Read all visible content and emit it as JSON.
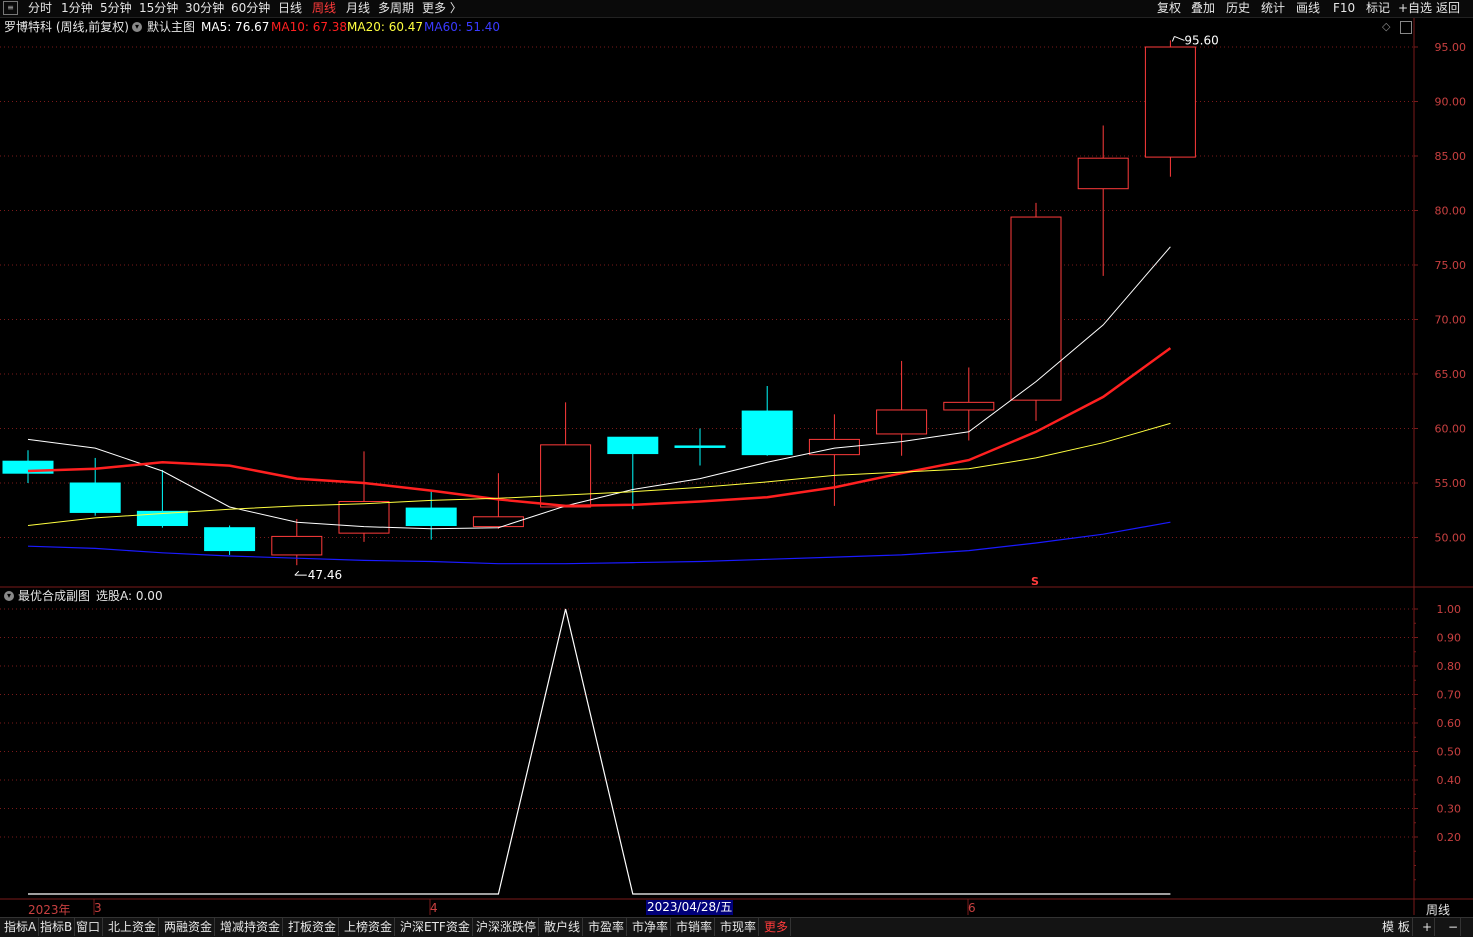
{
  "toolbar": {
    "periods": [
      "分时",
      "1分钟",
      "5分钟",
      "15分钟",
      "30分钟",
      "60分钟",
      "日线",
      "周线",
      "月线",
      "多周期",
      "更多 〉"
    ],
    "active_period": "周线",
    "right_buttons": [
      "复权",
      "叠加",
      "历史",
      "统计",
      "画线",
      "F10",
      "标记",
      "+自选",
      "返回"
    ]
  },
  "main_header": {
    "stock": "罗博特科 (周线,前复权)",
    "template": "默认主图",
    "ma5": "MA5: 76.67",
    "ma10": "MA10: 67.38",
    "ma20": "MA20: 60.47",
    "ma60": "MA60: 51.40"
  },
  "sub_header": {
    "title": "最优合成副图",
    "value": "选股A: 0.00"
  },
  "colors": {
    "up": "#ff3b3b",
    "down": "#00ffff",
    "ma5": "#ffffff",
    "ma10": "#ff2020",
    "ma20": "#ffff40",
    "ma60": "#1a1aff",
    "grid": "#7a1a1a"
  },
  "x_axis": {
    "labels": [
      "2023年",
      "3",
      "4",
      "6"
    ],
    "highlight": "2023/04/28/五",
    "period_label": "周线"
  },
  "chart_data": [
    {
      "type": "candlestick",
      "title": "",
      "ylim": [
        45.5,
        97.5
      ],
      "y_ticks": [
        "95.00",
        "90.00",
        "85.00",
        "80.00",
        "75.00",
        "70.00",
        "65.00",
        "60.00",
        "55.00",
        "50.00"
      ],
      "candles": [
        {
          "o": 57.0,
          "c": 55.9,
          "h": 58.0,
          "l": 55.0
        },
        {
          "o": 55.0,
          "c": 52.3,
          "h": 57.3,
          "l": 52.0
        },
        {
          "o": 52.4,
          "c": 51.1,
          "h": 56.2,
          "l": 50.9
        },
        {
          "o": 50.9,
          "c": 48.8,
          "h": 51.1,
          "l": 48.4
        },
        {
          "o": 48.4,
          "c": 50.1,
          "h": 51.7,
          "l": 47.46
        },
        {
          "o": 50.4,
          "c": 53.3,
          "h": 57.9,
          "l": 49.6
        },
        {
          "o": 52.7,
          "c": 51.1,
          "h": 54.4,
          "l": 49.8
        },
        {
          "o": 51.0,
          "c": 51.9,
          "h": 55.9,
          "l": 50.8
        },
        {
          "o": 52.8,
          "c": 58.5,
          "h": 62.4,
          "l": 52.8
        },
        {
          "o": 59.2,
          "c": 57.7,
          "h": 59.2,
          "l": 52.6
        },
        {
          "o": 58.4,
          "c": 58.3,
          "h": 60.0,
          "l": 56.6
        },
        {
          "o": 61.6,
          "c": 57.6,
          "h": 63.9,
          "l": 57.5
        },
        {
          "o": 57.6,
          "c": 59.0,
          "h": 61.3,
          "l": 52.9
        },
        {
          "o": 59.5,
          "c": 61.7,
          "h": 66.2,
          "l": 57.5
        },
        {
          "o": 61.7,
          "c": 62.4,
          "h": 65.6,
          "l": 58.9
        },
        {
          "o": 62.6,
          "c": 79.4,
          "h": 80.7,
          "l": 60.7
        },
        {
          "o": 82.0,
          "c": 84.8,
          "h": 87.8,
          "l": 74.0
        },
        {
          "o": 84.9,
          "c": 95.0,
          "h": 95.6,
          "l": 83.1
        }
      ],
      "series": [
        {
          "name": "MA5",
          "values": [
            59.0,
            58.2,
            56.1,
            52.8,
            51.4,
            51.0,
            50.8,
            50.9,
            52.9,
            54.4,
            55.4,
            56.9,
            58.2,
            58.8,
            59.7,
            64.3,
            69.5,
            76.67
          ]
        },
        {
          "name": "MA10",
          "values": [
            56.1,
            56.3,
            56.9,
            56.6,
            55.4,
            55.0,
            54.3,
            53.5,
            52.9,
            53.0,
            53.3,
            53.7,
            54.6,
            55.9,
            57.1,
            59.7,
            62.9,
            67.38
          ]
        },
        {
          "name": "MA20",
          "values": [
            51.1,
            51.8,
            52.2,
            52.6,
            52.9,
            53.1,
            53.4,
            53.6,
            53.9,
            54.2,
            54.6,
            55.1,
            55.7,
            56.0,
            56.3,
            57.3,
            58.7,
            60.47
          ]
        },
        {
          "name": "MA60",
          "values": [
            49.2,
            49.0,
            48.6,
            48.3,
            48.1,
            47.9,
            47.8,
            47.6,
            47.6,
            47.7,
            47.8,
            48.0,
            48.2,
            48.4,
            48.8,
            49.5,
            50.3,
            51.4
          ]
        }
      ],
      "annotations": [
        "95.60",
        "47.46",
        "S"
      ]
    },
    {
      "type": "line",
      "title": "",
      "ylim": [
        0,
        1.05
      ],
      "y_ticks": [
        "1.00",
        "0.90",
        "0.80",
        "0.70",
        "0.60",
        "0.50",
        "0.40",
        "0.30",
        "0.20"
      ],
      "series": [
        {
          "name": "选股A",
          "values": [
            0,
            0,
            0,
            0,
            0,
            0,
            0,
            0,
            1,
            0,
            0,
            0,
            0,
            0,
            0,
            0,
            0,
            0
          ]
        }
      ]
    }
  ]
}
